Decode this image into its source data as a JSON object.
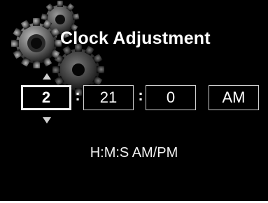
{
  "title": "Clock Adjustment",
  "time": {
    "hours": "2",
    "minutes": "21",
    "seconds": "0",
    "period": "AM",
    "separator": ":"
  },
  "hint": "H:M:S AM/PM",
  "icons": {
    "background": "gears-icon",
    "increase": "arrow-up-icon",
    "decrease": "arrow-down-icon"
  },
  "colors": {
    "background": "#000000",
    "text": "#ffffff",
    "field_border": "#cfcfcf",
    "selected_border": "#f2f2f2"
  },
  "selected_field": "hours"
}
